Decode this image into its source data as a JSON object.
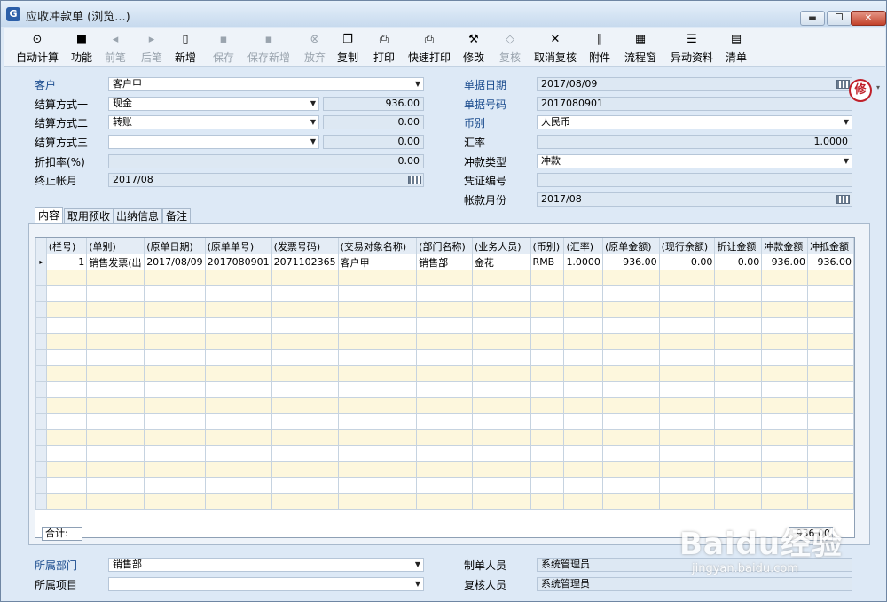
{
  "window": {
    "title": "应收冲款单 (浏览...)",
    "app_icon": "G"
  },
  "toolbar": [
    {
      "label": "自动计算",
      "icon": "calc-icon",
      "glyph": "⊙",
      "enabled": true
    },
    {
      "label": "功能",
      "icon": "box-icon",
      "glyph": "■",
      "enabled": true
    },
    {
      "label": "前笔",
      "icon": "arrow-left-icon",
      "glyph": "◂",
      "enabled": false
    },
    {
      "label": "后笔",
      "icon": "arrow-right-icon",
      "glyph": "▸",
      "enabled": false
    },
    {
      "label": "新增",
      "icon": "new-doc-icon",
      "glyph": "▯",
      "enabled": true
    },
    {
      "label": "保存",
      "icon": "save-icon",
      "glyph": "▪",
      "enabled": false
    },
    {
      "label": "保存新增",
      "icon": "save-new-icon",
      "glyph": "▪",
      "enabled": false
    },
    {
      "label": "放弃",
      "icon": "cancel-icon",
      "glyph": "⊗",
      "enabled": false
    },
    {
      "label": "复制",
      "icon": "copy-icon",
      "glyph": "❐",
      "enabled": true
    },
    {
      "label": "打印",
      "icon": "printer-icon",
      "glyph": "⎙",
      "enabled": true
    },
    {
      "label": "快速打印",
      "icon": "quick-print-icon",
      "glyph": "⎙",
      "enabled": true
    },
    {
      "label": "修改",
      "icon": "hammer-icon",
      "glyph": "⚒",
      "enabled": true
    },
    {
      "label": "复核",
      "icon": "review-icon",
      "glyph": "◇",
      "enabled": false
    },
    {
      "label": "取消复核",
      "icon": "cancel-review-icon",
      "glyph": "✕",
      "enabled": true
    },
    {
      "label": "附件",
      "icon": "paperclip-icon",
      "glyph": "∥",
      "enabled": true
    },
    {
      "label": "流程窗",
      "icon": "flow-icon",
      "glyph": "▦",
      "enabled": true
    },
    {
      "label": "异动资料",
      "icon": "history-icon",
      "glyph": "☰",
      "enabled": true
    },
    {
      "label": "清单",
      "icon": "list-icon",
      "glyph": "▤",
      "enabled": true
    }
  ],
  "header": {
    "customer_label": "客户",
    "customer_value": "客户甲",
    "settle1_label": "结算方式一",
    "settle1_value": "现金",
    "settle1_amount": "936.00",
    "settle2_label": "结算方式二",
    "settle2_value": "转账",
    "settle2_amount": "0.00",
    "settle3_label": "结算方式三",
    "settle3_value": "",
    "settle3_amount": "0.00",
    "discount_label": "折扣率(%)",
    "discount_value": "0.00",
    "end_month_label": "终止帐月",
    "end_month_value": "2017/08",
    "doc_date_label": "单据日期",
    "doc_date_value": "2017/08/09",
    "doc_no_label": "单据号码",
    "doc_no_value": "2017080901",
    "currency_label": "币别",
    "currency_value": "人民币",
    "rate_label": "汇率",
    "rate_value": "1.0000",
    "offset_type_label": "冲款类型",
    "offset_type_value": "冲款",
    "voucher_label": "凭证编号",
    "voucher_value": "",
    "account_month_label": "帐款月份",
    "account_month_value": "2017/08",
    "seal_text": "修"
  },
  "tabs": [
    "内容",
    "取用预收",
    "出纳信息",
    "备注"
  ],
  "grid": {
    "columns": [
      "(栏号)",
      "(单别)",
      "(原单日期)",
      "(原单单号)",
      "(发票号码)",
      "(交易对象名称)",
      "(部门名称)",
      "(业务人员)",
      "(币别)",
      "(汇率)",
      "(原单金额)",
      "(现行余额)",
      "折让金额",
      "冲款金额",
      "冲抵金额"
    ],
    "rows": [
      [
        "1",
        "销售发票(出",
        "2017/08/09",
        "2017080901",
        "2071102365",
        "客户甲",
        "销售部",
        "金花",
        "RMB",
        "1.0000",
        "936.00",
        "0.00",
        "0.00",
        "936.00",
        "936.00"
      ]
    ],
    "total_label": "合计:",
    "total_value": "936.00"
  },
  "footer": {
    "dept_label": "所属部门",
    "dept_value": "销售部",
    "project_label": "所属项目",
    "project_value": "",
    "maker_label": "制单人员",
    "maker_value": "系统管理员",
    "reviewer_label": "复核人员",
    "reviewer_value": "系统管理员"
  },
  "watermark": {
    "logo": "Baidu经验",
    "url": "jingyan.baidu.com"
  }
}
